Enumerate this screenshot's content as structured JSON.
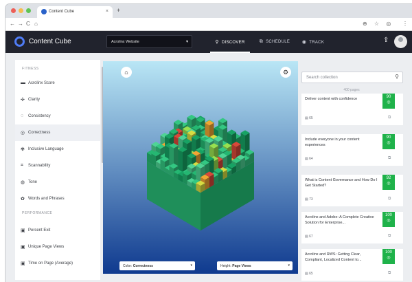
{
  "browser": {
    "tab_title": "Content Cube",
    "tab_close": "×",
    "new_tab": "+",
    "nav_back": "←",
    "nav_forward": "→",
    "nav_reload": "C",
    "nav_home": "⌂",
    "ext_icons": "⊕ ☆ ◎",
    "menu": "⋮",
    "traffic_colors": [
      "#ee5f57",
      "#f5bd4f",
      "#5fc454"
    ]
  },
  "header": {
    "brand": "Content Cube",
    "site_select": "Acrolinx Website",
    "nav": [
      {
        "label": "DISCOVER",
        "icon": "search-icon",
        "glyph": "⚲"
      },
      {
        "label": "SCHEDULE",
        "icon": "schedule-icon",
        "glyph": "⧉"
      },
      {
        "label": "TRACK",
        "icon": "eye-icon",
        "glyph": "◉"
      }
    ],
    "share_glyph": "⇪"
  },
  "sidebar": {
    "sections": [
      {
        "title": "FITNESS",
        "items": [
          {
            "label": "Acrolinx Score",
            "icon": "score-icon",
            "glyph": "▬"
          },
          {
            "label": "Clarity",
            "icon": "clarity-icon",
            "glyph": "✣"
          },
          {
            "label": "Consistency",
            "icon": "consistency-icon",
            "glyph": "◌"
          },
          {
            "label": "Correctness",
            "icon": "correctness-icon",
            "glyph": "◎",
            "selected": true
          },
          {
            "label": "Inclusive Language",
            "icon": "inclusive-icon",
            "glyph": "✾"
          },
          {
            "label": "Scannability",
            "icon": "scannability-icon",
            "glyph": "⌗"
          },
          {
            "label": "Tone",
            "icon": "tone-icon",
            "glyph": "◍"
          },
          {
            "label": "Words and Phrases",
            "icon": "words-icon",
            "glyph": "✿"
          }
        ]
      },
      {
        "title": "PERFORMANCE",
        "items": [
          {
            "label": "Percent Exit",
            "icon": "exit-icon",
            "glyph": "▣"
          },
          {
            "label": "Unique Page Views",
            "icon": "views-icon",
            "glyph": "▣"
          },
          {
            "label": "Time on Page (Average)",
            "icon": "time-icon",
            "glyph": "▣"
          }
        ]
      }
    ]
  },
  "visualization": {
    "home_glyph": "⌂",
    "gear_glyph": "⚙",
    "color_label": "Color:",
    "color_value": "Correctness",
    "height_label": "Height:",
    "height_value": "Page Views",
    "caret": "▾",
    "sky_top": "#b9e6f5",
    "sky_bottom": "#0f3a8f",
    "palette": [
      "#22a96a",
      "#2fb878",
      "#15975d",
      "#49c48a",
      "#8dcf4a",
      "#c7cc3d",
      "#e09a2f",
      "#c94335"
    ]
  },
  "collection": {
    "search_placeholder": "Search collection",
    "search_glyph": "⚲",
    "count": "400 pages",
    "score_glyph": "◎",
    "open_glyph": "⧉",
    "cards": [
      {
        "title": "Deliver content with confidence",
        "id": "65",
        "score": "90"
      },
      {
        "title": "Include everyone in your content experiences",
        "id": "64",
        "score": "90"
      },
      {
        "title": "What is Content Governance and How Do I Get Started?",
        "id": "73",
        "score": "92"
      },
      {
        "title": "Acrolinx and Adobe: A Complete Creative Solution for Enterprise...",
        "id": "67",
        "score": "100"
      },
      {
        "title": "Acrolinx and RWS: Getting Clear, Compliant, Localized Content to...",
        "id": "65",
        "score": "100"
      }
    ]
  }
}
